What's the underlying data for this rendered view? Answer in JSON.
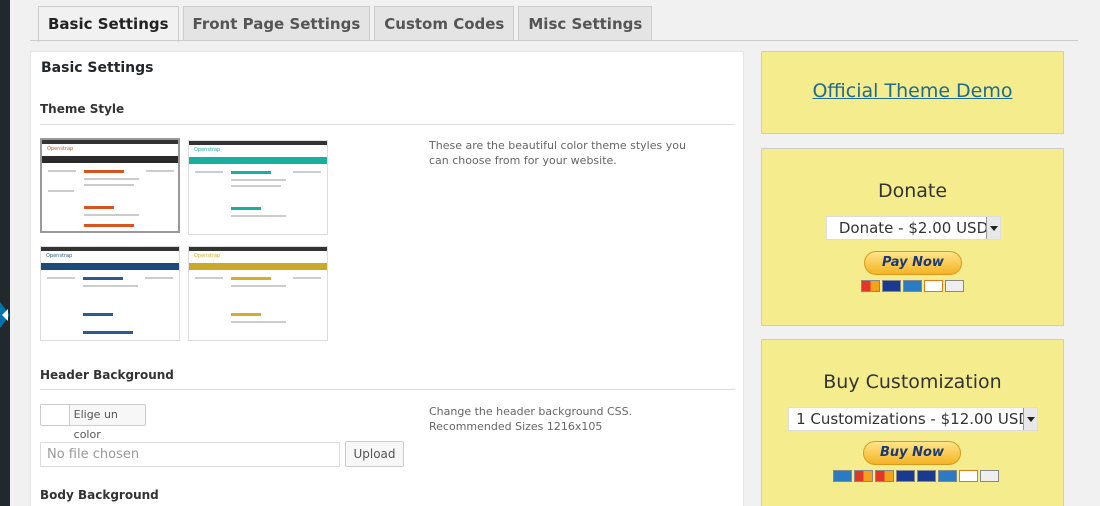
{
  "tabs": [
    {
      "label": "Basic Settings",
      "active": true
    },
    {
      "label": "Front Page Settings",
      "active": false
    },
    {
      "label": "Custom Codes",
      "active": false
    },
    {
      "label": "Misc Settings",
      "active": false
    }
  ],
  "panel": {
    "title": "Basic Settings",
    "theme_style": {
      "label": "Theme Style",
      "description": "These are the beautiful color theme styles you can choose from for your website.",
      "thumbnails": [
        {
          "name": "Openstrap",
          "accent": "#d9541e",
          "nav": "#2a2a2a",
          "selected": true
        },
        {
          "name": "Openstrap",
          "accent": "#1aae9f",
          "nav": "#1aae9f",
          "selected": false
        },
        {
          "name": "Openstrap",
          "accent": "#2a5a8f",
          "nav": "#1c4a7a",
          "selected": false
        },
        {
          "name": "Openstrap",
          "accent": "#d4ae2a",
          "nav": "#c9a82a",
          "selected": false
        }
      ]
    },
    "header_background": {
      "label": "Header Background",
      "color_button": "Elige un color",
      "file_placeholder": "No file chosen",
      "upload_label": "Upload",
      "description_line1": "Change the header background CSS.",
      "description_line2": "Recommended Sizes 1216x105"
    },
    "body_background": {
      "label": "Body Background"
    }
  },
  "sidebar": {
    "demo_link": "Official Theme Demo",
    "donate": {
      "title": "Donate",
      "selected": "Donate - $2.00 USD",
      "button": "Pay Now"
    },
    "customization": {
      "title": "Buy Customization",
      "selected": "1 Customizations - $12.00 USD",
      "button": "Buy Now"
    }
  },
  "colors": {
    "box_bg": "#f5ec8e",
    "link": "#1f6b8b",
    "accent": "#0073aa"
  }
}
